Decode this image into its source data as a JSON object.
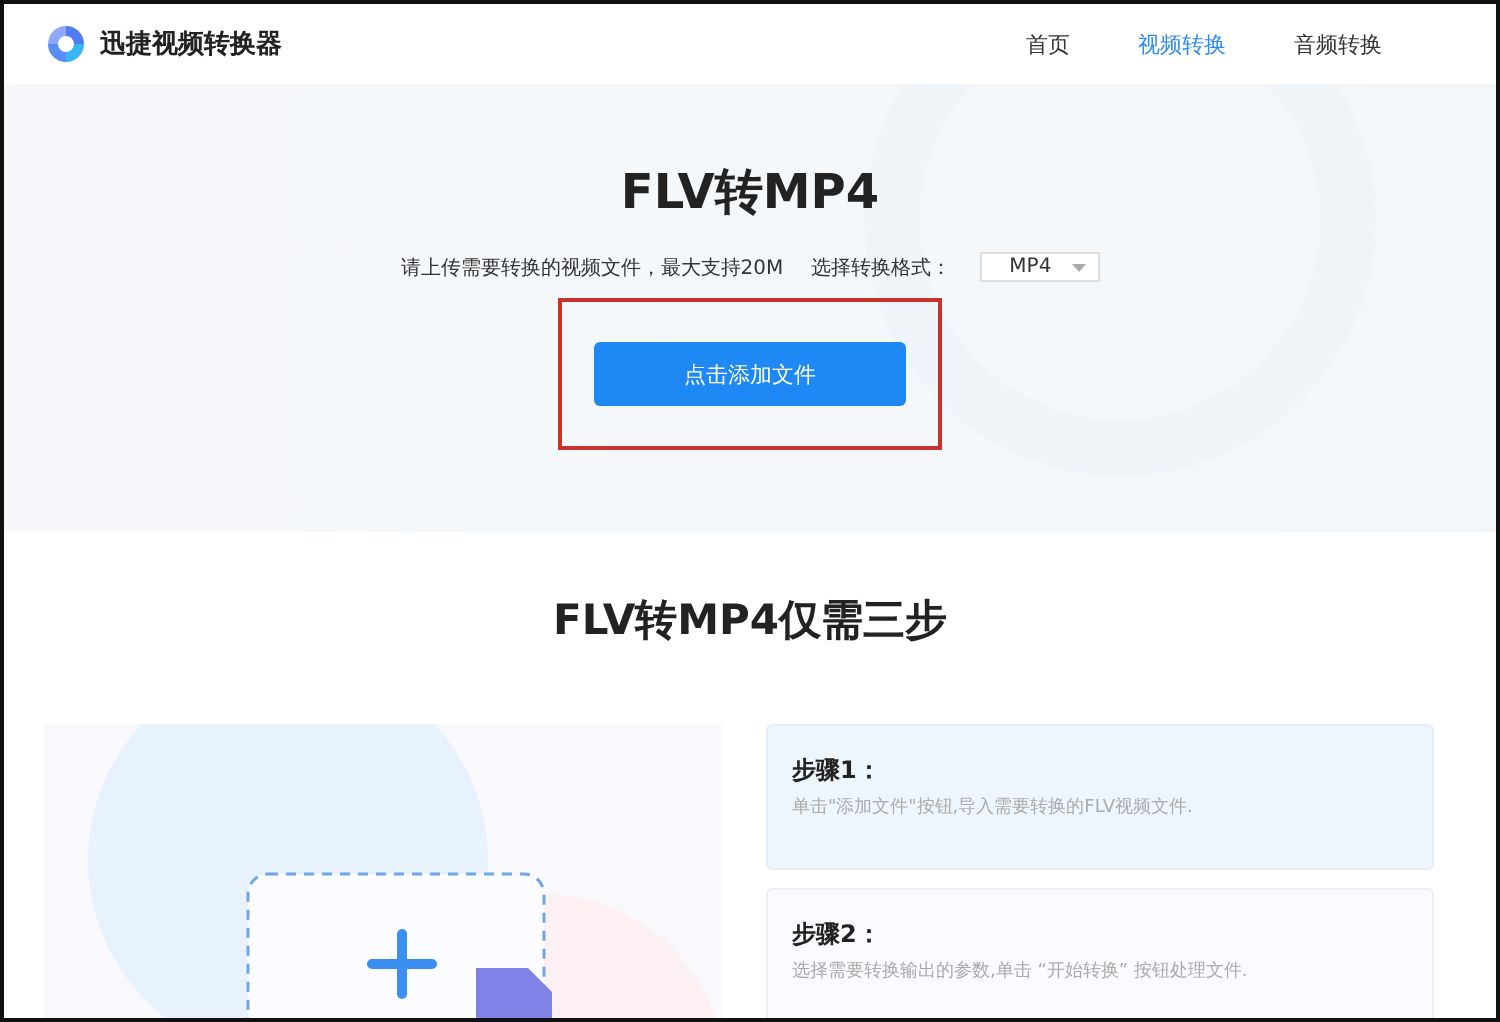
{
  "header": {
    "logo_text": "迅捷视频转换器",
    "nav": [
      {
        "label": "首页",
        "selected": false
      },
      {
        "label": "视频转换",
        "selected": true
      },
      {
        "label": "音频转换",
        "selected": false
      }
    ]
  },
  "hero": {
    "title": "FLV转MP4",
    "hint": "请上传需要转换的视频文件，最大支持20M",
    "format_label": "选择转换格式：",
    "format_value": "MP4",
    "upload_button": "点击添加文件"
  },
  "steps_section": {
    "title": "FLV转MP4仅需三步",
    "steps": [
      {
        "title": "步骤1：",
        "text": "单击\"添加文件\"按钮,导入需要转换的FLV视频文件.",
        "selected": true
      },
      {
        "title": "步骤2：",
        "text": "选择需要转换输出的参数,单击 “开始转换” 按钮处理文件.",
        "selected": false
      }
    ]
  }
}
